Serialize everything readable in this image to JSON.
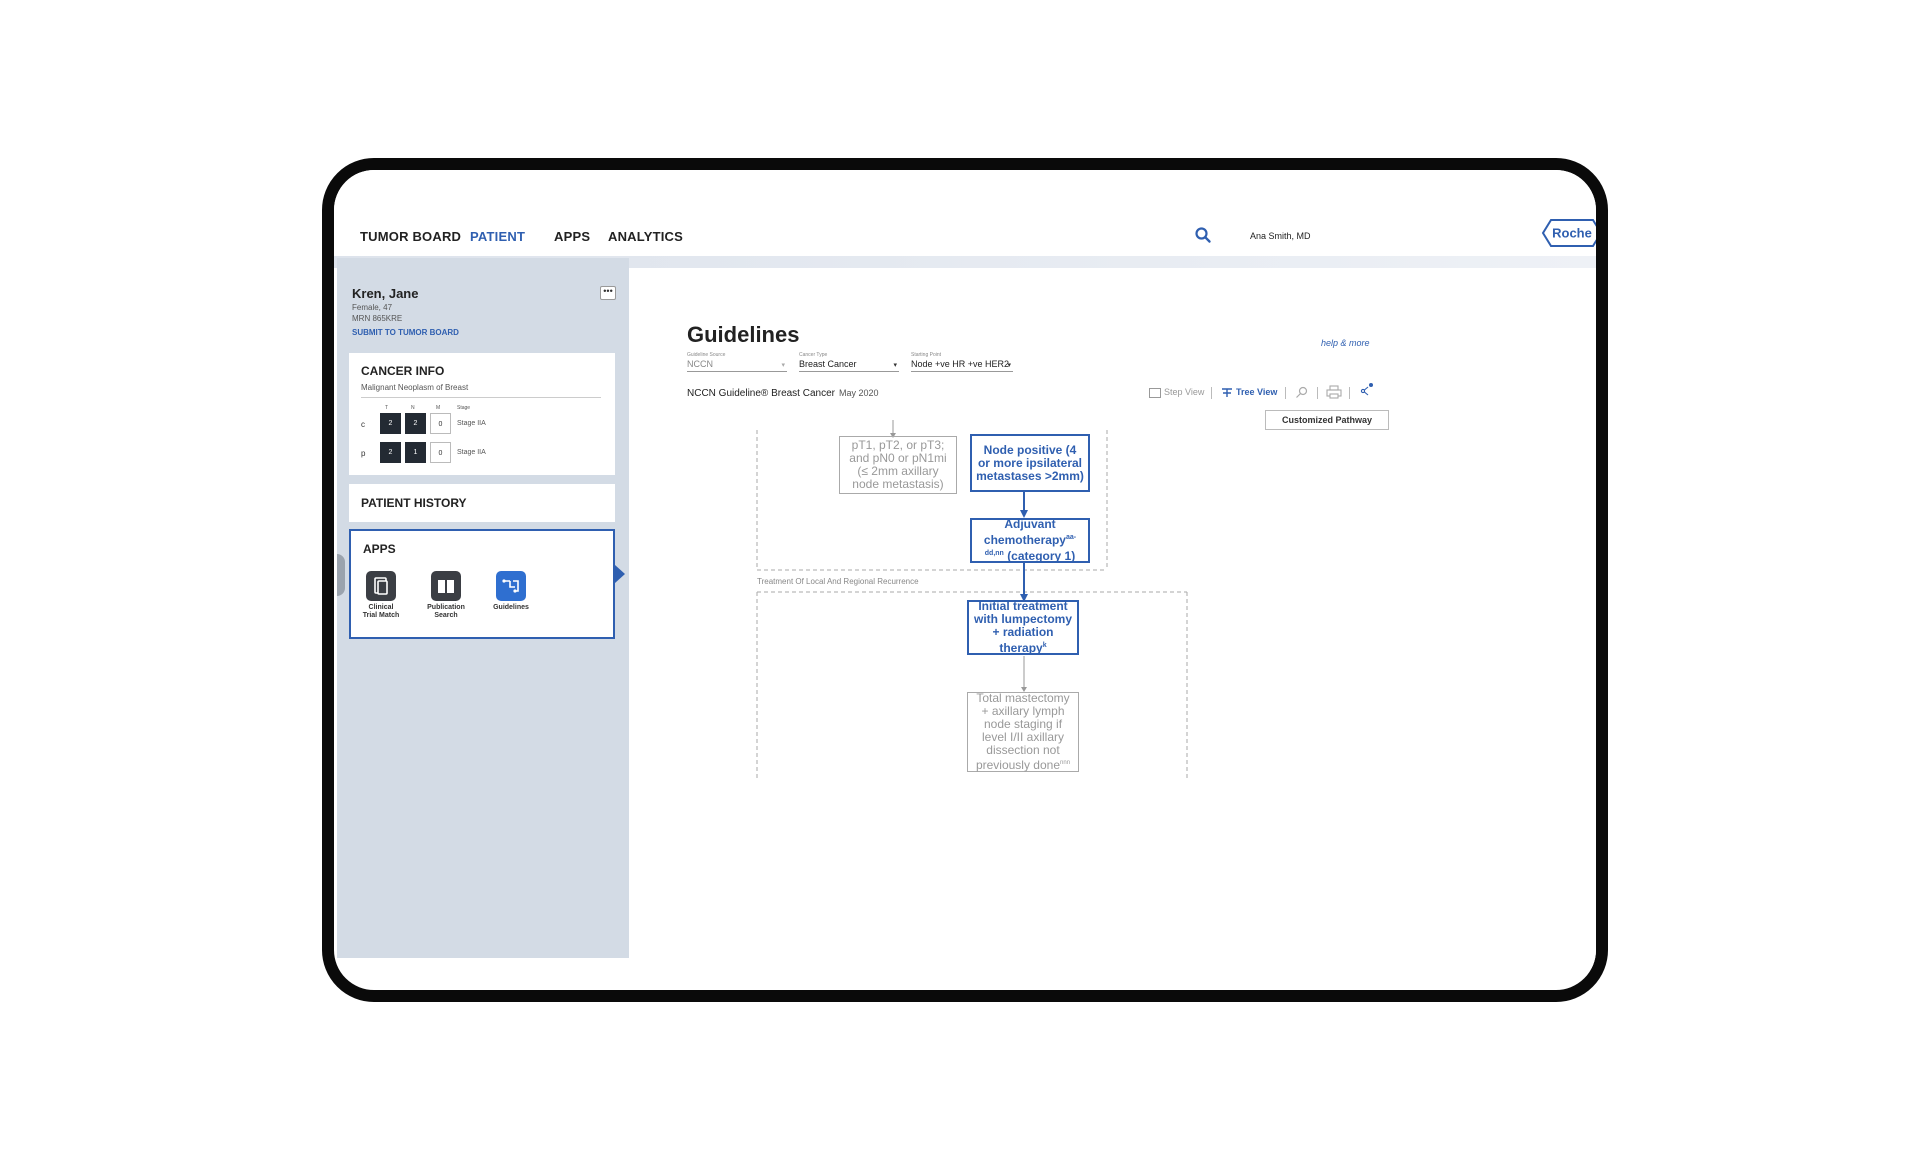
{
  "nav": {
    "items": [
      {
        "label": "TUMOR BOARD",
        "active": false
      },
      {
        "label": "PATIENT",
        "active": true
      },
      {
        "label": "APPS",
        "active": false
      },
      {
        "label": "ANALYTICS",
        "active": false
      }
    ],
    "user": "Ana Smith, MD",
    "logo": "Roche",
    "accent_color": "#2f5fb0"
  },
  "patient": {
    "name": "Kren, Jane",
    "gender_age": "Female, 47",
    "mrn": "MRN 865KRE",
    "submit_label": "SUBMIT TO TUMOR BOARD",
    "more_label": "•••"
  },
  "cancer_info": {
    "title": "CANCER INFO",
    "diagnosis": "Malignant Neoplasm of Breast",
    "headers": [
      "T",
      "N",
      "M",
      "Stage"
    ],
    "rows": [
      {
        "prefix": "c",
        "t": "2",
        "n": "2",
        "m": "0",
        "stage": "Stage IIA"
      },
      {
        "prefix": "p",
        "t": "2",
        "n": "1",
        "m": "0",
        "stage": "Stage IIA"
      }
    ]
  },
  "patient_history": {
    "title": "PATIENT HISTORY"
  },
  "apps": {
    "title": "APPS",
    "items": [
      {
        "label_line1": "Clinical",
        "label_line2": "Trial Match",
        "icon": "document-icon"
      },
      {
        "label_line1": "Publication",
        "label_line2": "Search",
        "icon": "book-icon"
      },
      {
        "label_line1": "Guidelines",
        "label_line2": "",
        "icon": "flowchart-icon",
        "active": true
      }
    ]
  },
  "guidelines": {
    "title": "Guidelines",
    "help": "help & more",
    "selectors": [
      {
        "caption": "Guideline Source",
        "value": "NCCN"
      },
      {
        "caption": "Cancer Type",
        "value": "Breast Cancer"
      },
      {
        "caption": "Starting Point",
        "value": "Node +ve HR +ve HER2"
      }
    ],
    "guideline_name": "NCCN Guideline® Breast Cancer",
    "guideline_date": "May 2020",
    "views": {
      "step": "Step View",
      "tree": "Tree View"
    },
    "customized_pathway": "Customized Pathway",
    "section_label": "Treatment Of Local And Regional Recurrence",
    "nodes": {
      "a": "pT1, pT2, or pT3; and pN0 or pN1mi (≤ 2mm axillary node metastasis)",
      "b": "Node positive (4 or more ipsilateral metastases >2mm)",
      "c_main": "Adjuvant chemotherapy",
      "c_sup": "aa-dd,nn",
      "c_tail": "(category 1)",
      "d_main": "Initial treatment with lumpectomy + radiation therapy",
      "d_sup": "k",
      "e_main": "Total mastectomy + axillary lymph node staging if level I/II axillary dissection not previously done",
      "e_sup": "nnn"
    }
  }
}
